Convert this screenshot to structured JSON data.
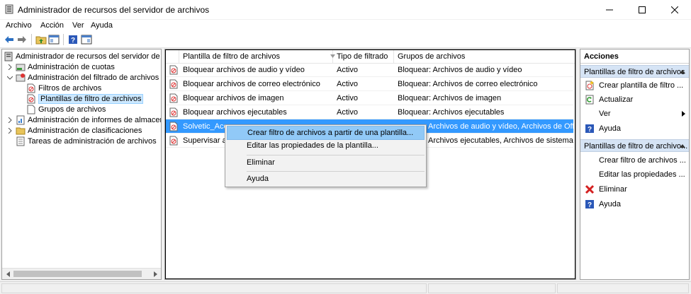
{
  "window": {
    "title": "Administrador de recursos del servidor de archivos"
  },
  "menubar": {
    "items": [
      "Archivo",
      "Acción",
      "Ver",
      "Ayuda"
    ]
  },
  "toolbar": {
    "buttons": [
      "back-arrow-icon",
      "forward-arrow-icon",
      "up-folder-icon",
      "show-hide-tree-icon",
      "help-icon",
      "properties-icon"
    ]
  },
  "tree": {
    "root": "Administrador de recursos del servidor de arch",
    "items": [
      "Administración de cuotas",
      "Administración del filtrado de archivos",
      "Filtros de archivos",
      "Plantillas de filtro de archivos",
      "Grupos de archivos",
      "Administración de informes de almacenam",
      "Administración de clasificaciones",
      "Tareas de administración de archivos"
    ]
  },
  "list": {
    "columns": [
      "Plantilla de filtro de archivos",
      "Tipo de filtrado",
      "Grupos de archivos"
    ],
    "rows": [
      {
        "name": "Bloquear archivos de audio y vídeo",
        "type": "Activo",
        "groups": "Bloquear: Archivos de audio y vídeo"
      },
      {
        "name": "Bloquear archivos de correo electrónico",
        "type": "Activo",
        "groups": "Bloquear: Archivos de correo electrónico"
      },
      {
        "name": "Bloquear archivos de imagen",
        "type": "Activo",
        "groups": "Bloquear: Archivos de imagen"
      },
      {
        "name": "Bloquear archivos ejecutables",
        "type": "Activo",
        "groups": "Bloquear: Archivos ejecutables"
      },
      {
        "name": "Solvetic_Acce",
        "type": "",
        "groups": "Archivos de audio y vídeo, Archivos de Office..."
      },
      {
        "name": "Supervisar arc",
        "type": "",
        "groups": "Archivos ejecutables, Archivos de sistema"
      }
    ]
  },
  "context_menu": {
    "items": [
      "Crear filtro de archivos a partir de una plantilla...",
      "Editar las propiedades de la plantilla...",
      "Eliminar",
      "Ayuda"
    ]
  },
  "actions": {
    "title": "Acciones",
    "group1": {
      "title": "Plantillas de filtro de archivos",
      "items": [
        "Crear plantilla de filtro ...",
        "Actualizar",
        "Ver",
        "Ayuda"
      ]
    },
    "group2": {
      "title": "Plantillas de filtro de archivo...",
      "items": [
        "Crear filtro de archivos ...",
        "Editar las propiedades ...",
        "Eliminar",
        "Ayuda"
      ]
    }
  },
  "colors": {
    "selection": "#3399ff",
    "context_highlight": "#91c9f7",
    "action_group_bg": "#d6e4f5"
  }
}
